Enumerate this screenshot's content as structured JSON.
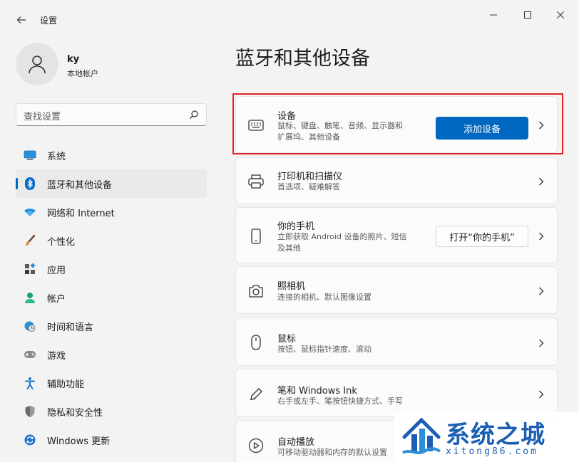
{
  "window": {
    "title": "设置"
  },
  "profile": {
    "name": "ky",
    "account_type": "本地帐户"
  },
  "search": {
    "placeholder": "查找设置"
  },
  "nav": {
    "items": [
      {
        "label": "系统",
        "icon": "monitor-icon"
      },
      {
        "label": "蓝牙和其他设备",
        "icon": "bluetooth-icon",
        "active": true
      },
      {
        "label": "网络和 Internet",
        "icon": "wifi-icon"
      },
      {
        "label": "个性化",
        "icon": "brush-icon"
      },
      {
        "label": "应用",
        "icon": "apps-icon"
      },
      {
        "label": "帐户",
        "icon": "person-icon"
      },
      {
        "label": "时间和语言",
        "icon": "clock-globe-icon"
      },
      {
        "label": "游戏",
        "icon": "gamepad-icon"
      },
      {
        "label": "辅助功能",
        "icon": "accessibility-icon"
      },
      {
        "label": "隐私和安全性",
        "icon": "shield-icon"
      },
      {
        "label": "Windows 更新",
        "icon": "update-icon"
      }
    ]
  },
  "main": {
    "title": "蓝牙和其他设备",
    "cards": [
      {
        "title": "设备",
        "desc_line1": "鼠标、键盘、触笔、音频、显示器和",
        "desc_line2": "扩展坞、其他设备",
        "button": "添加设备",
        "icon": "devices-icon"
      },
      {
        "title": "打印机和扫描仪",
        "desc_line1": "首选项、疑难解答",
        "icon": "printer-icon"
      },
      {
        "title": "你的手机",
        "desc_line1": "立即获取 Android 设备的照片、短信",
        "desc_line2": "及其他",
        "button": "打开“你的手机”",
        "icon": "phone-icon"
      },
      {
        "title": "照相机",
        "desc_line1": "连接的相机、默认图像设置",
        "icon": "camera-icon"
      },
      {
        "title": "鼠标",
        "desc_line1": "按钮、鼠标指针速度、滚动",
        "icon": "mouse-icon"
      },
      {
        "title": "笔和 Windows Ink",
        "desc_line1": "右手或左手、笔按钮快捷方式、手写",
        "icon": "pen-icon"
      },
      {
        "title": "自动播放",
        "desc_line1": "可移动驱动器和内存的默认设置",
        "icon": "autoplay-icon"
      }
    ]
  },
  "watermark": {
    "brand": "系统之城",
    "url": "xitong86.com"
  },
  "colors": {
    "accent": "#0067c0",
    "highlight": "#e02424",
    "watermark": "#1a5fb4"
  }
}
